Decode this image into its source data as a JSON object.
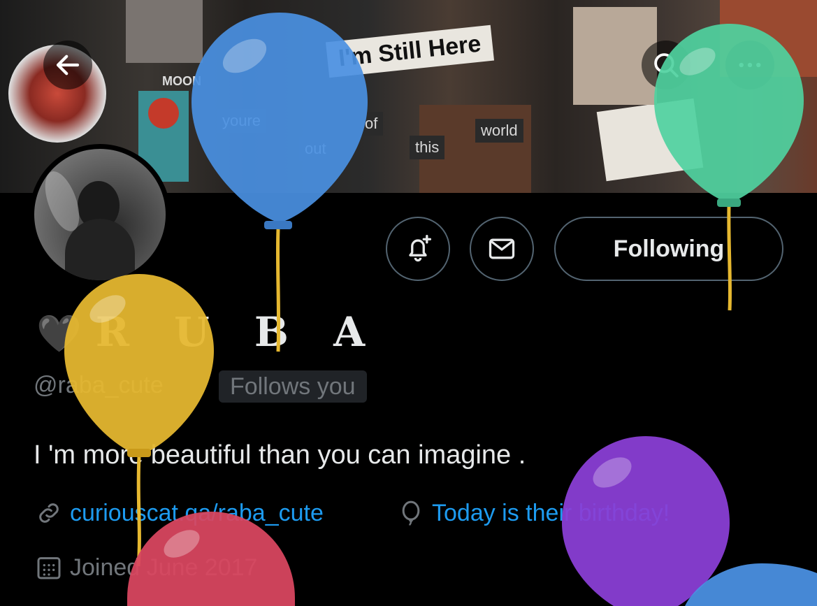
{
  "banner": {
    "label_still": "I'm Still Here",
    "label_youre": "youre",
    "label_out": "out",
    "label_of": "of",
    "label_this": "this",
    "label_world": "world",
    "label_moon": "MOON"
  },
  "nav": {
    "back_icon": "back-arrow-icon",
    "search_icon": "search-icon",
    "more_icon": "more-icon"
  },
  "actions": {
    "notify_icon": "bell-plus-icon",
    "message_icon": "mail-icon",
    "follow_label": "Following"
  },
  "profile": {
    "heart": "🖤",
    "display_name": "R U B A",
    "handle": "@raba_cute",
    "follows_you": "Follows you",
    "bio": "I 'm more beautiful than you can imagine .",
    "website": "curiouscat.qa/raba_cute",
    "birthday": "Today is their birthday!",
    "joined": "Joined June 2017"
  },
  "colors": {
    "link": "#1d9bf0",
    "muted": "#71767b",
    "balloon_blue": "#4a90e2",
    "balloon_green": "#4fd1a0",
    "balloon_yellow": "#e6b830",
    "balloon_red": "#d94660",
    "balloon_purple": "#8a3fd6"
  }
}
